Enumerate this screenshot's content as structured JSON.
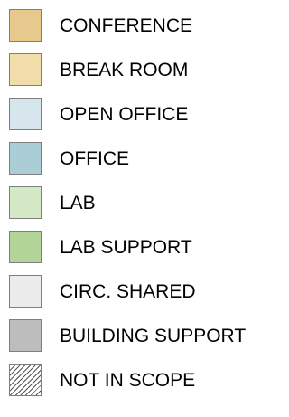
{
  "legend": {
    "items": [
      {
        "label": "CONFERENCE",
        "color": "#e8c98d",
        "pattern": "solid"
      },
      {
        "label": "BREAK ROOM",
        "color": "#f2ddaa",
        "pattern": "solid"
      },
      {
        "label": "OPEN OFFICE",
        "color": "#d6e6ec",
        "pattern": "solid"
      },
      {
        "label": "OFFICE",
        "color": "#abcdd6",
        "pattern": "solid"
      },
      {
        "label": "LAB",
        "color": "#d3e8c5",
        "pattern": "solid"
      },
      {
        "label": "LAB SUPPORT",
        "color": "#b2d597",
        "pattern": "solid"
      },
      {
        "label": "CIRC. SHARED",
        "color": "#ececec",
        "pattern": "solid"
      },
      {
        "label": "BUILDING SUPPORT",
        "color": "#bdbdbd",
        "pattern": "solid"
      },
      {
        "label": "NOT IN SCOPE",
        "color": "#ffffff",
        "pattern": "diagonal-hatch"
      }
    ]
  }
}
